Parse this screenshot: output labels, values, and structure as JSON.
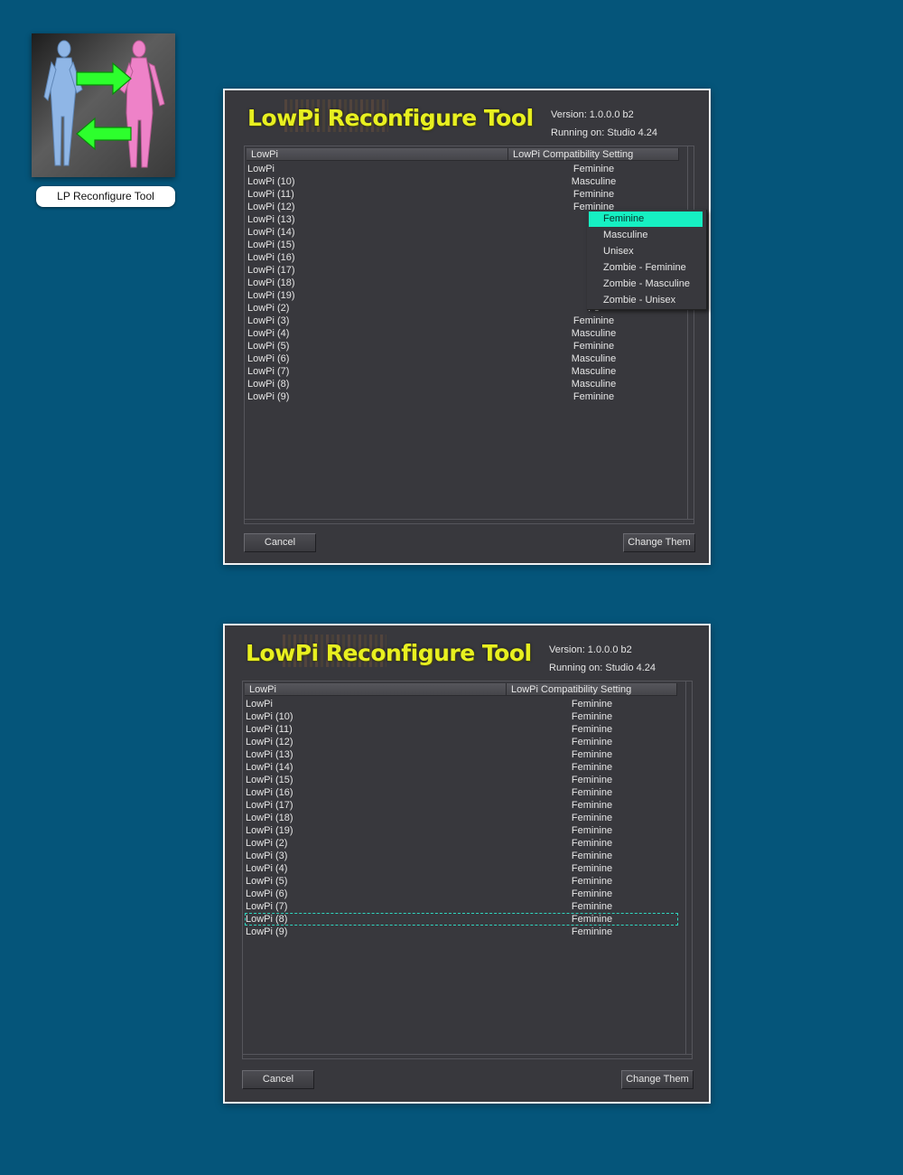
{
  "desktop_icon": {
    "label": "LP Reconfigure Tool",
    "colors": {
      "blue_figure": "#8fb6e6",
      "pink_figure": "#ee82c8",
      "arrow": "#2dff2d"
    }
  },
  "dialog_before": {
    "title": "LowPi Reconfigure Tool",
    "version": "Version: 1.0.0.0 b2",
    "running_on": "Running on: Studio 4.24",
    "columns": [
      "LowPi",
      "LowPi Compatibility Setting"
    ],
    "rows": [
      {
        "name": "LowPi",
        "setting": "Feminine"
      },
      {
        "name": "LowPi (10)",
        "setting": "Masculine"
      },
      {
        "name": "LowPi (11)",
        "setting": "Feminine"
      },
      {
        "name": "LowPi (12)",
        "setting": "Feminine"
      },
      {
        "name": "LowPi (13)",
        "setting": "Ma"
      },
      {
        "name": "LowPi (14)",
        "setting": "Fe"
      },
      {
        "name": "LowPi (15)",
        "setting": "Ma"
      },
      {
        "name": "LowPi (16)",
        "setting": "Fe"
      },
      {
        "name": "LowPi (17)",
        "setting": "Ma"
      },
      {
        "name": "LowPi (18)",
        "setting": "Fe"
      },
      {
        "name": "LowPi (19)",
        "setting": "Fe"
      },
      {
        "name": "LowPi (2)",
        "setting": "Fe"
      },
      {
        "name": "LowPi (3)",
        "setting": "Feminine"
      },
      {
        "name": "LowPi (4)",
        "setting": "Masculine"
      },
      {
        "name": "LowPi (5)",
        "setting": "Feminine"
      },
      {
        "name": "LowPi (6)",
        "setting": "Masculine"
      },
      {
        "name": "LowPi (7)",
        "setting": "Masculine"
      },
      {
        "name": "LowPi (8)",
        "setting": "Masculine"
      },
      {
        "name": "LowPi (9)",
        "setting": "Feminine"
      }
    ],
    "dropdown": {
      "options": [
        "Feminine",
        "Masculine",
        "Unisex",
        "Zombie - Feminine",
        "Zombie - Masculine",
        "Zombie - Unisex"
      ],
      "selected": "Feminine",
      "highlight_color": "#16f0c2"
    },
    "cancel_label": "Cancel",
    "change_label": "Change Them"
  },
  "dialog_after": {
    "title": "LowPi Reconfigure Tool",
    "version": "Version: 1.0.0.0 b2",
    "running_on": "Running on: Studio 4.24",
    "columns": [
      "LowPi",
      "LowPi Compatibility Setting"
    ],
    "rows": [
      {
        "name": "LowPi",
        "setting": "Feminine"
      },
      {
        "name": "LowPi (10)",
        "setting": "Feminine"
      },
      {
        "name": "LowPi (11)",
        "setting": "Feminine"
      },
      {
        "name": "LowPi (12)",
        "setting": "Feminine"
      },
      {
        "name": "LowPi (13)",
        "setting": "Feminine"
      },
      {
        "name": "LowPi (14)",
        "setting": "Feminine"
      },
      {
        "name": "LowPi (15)",
        "setting": "Feminine"
      },
      {
        "name": "LowPi (16)",
        "setting": "Feminine"
      },
      {
        "name": "LowPi (17)",
        "setting": "Feminine"
      },
      {
        "name": "LowPi (18)",
        "setting": "Feminine"
      },
      {
        "name": "LowPi (19)",
        "setting": "Feminine"
      },
      {
        "name": "LowPi (2)",
        "setting": "Feminine"
      },
      {
        "name": "LowPi (3)",
        "setting": "Feminine"
      },
      {
        "name": "LowPi (4)",
        "setting": "Feminine"
      },
      {
        "name": "LowPi (5)",
        "setting": "Feminine"
      },
      {
        "name": "LowPi (6)",
        "setting": "Feminine"
      },
      {
        "name": "LowPi (7)",
        "setting": "Feminine"
      },
      {
        "name": "LowPi (8)",
        "setting": "Feminine"
      },
      {
        "name": "LowPi (9)",
        "setting": "Feminine"
      }
    ],
    "focused_row": "LowPi (8)",
    "cancel_label": "Cancel",
    "change_label": "Change Them"
  },
  "colors": {
    "page_background": "#05557a",
    "dialog_background": "#38383d",
    "title_yellow": "#e8f020"
  }
}
